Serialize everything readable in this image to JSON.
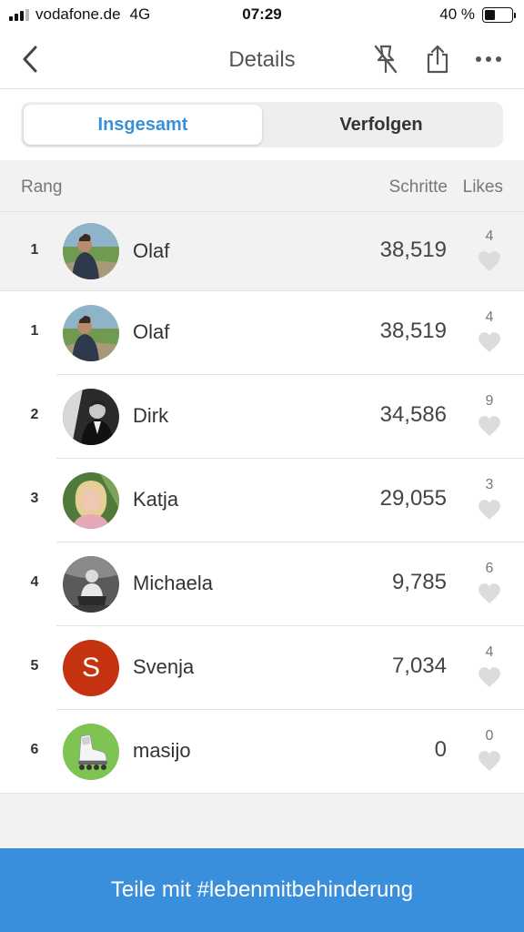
{
  "status_bar": {
    "carrier": "vodafone.de",
    "network": "4G",
    "time": "07:29",
    "battery": "40 %",
    "battery_level": 0.4
  },
  "nav": {
    "title": "Details",
    "icons": [
      "back-chevron-icon",
      "pin-off-icon",
      "share-icon",
      "more-icon"
    ]
  },
  "tabs": [
    {
      "label": "Insgesamt",
      "active": true
    },
    {
      "label": "Verfolgen",
      "active": false
    }
  ],
  "columns": {
    "rank": "Rang",
    "steps": "Schritte",
    "likes": "Likes"
  },
  "my_entry": {
    "rank": "1",
    "name": "Olaf",
    "steps": "38,519",
    "likes": "4"
  },
  "leaderboard": [
    {
      "rank": "1",
      "name": "Olaf",
      "steps": "38,519",
      "likes": "4"
    },
    {
      "rank": "2",
      "name": "Dirk",
      "steps": "34,586",
      "likes": "9"
    },
    {
      "rank": "3",
      "name": "Katja",
      "steps": "29,055",
      "likes": "3"
    },
    {
      "rank": "4",
      "name": "Michaela",
      "steps": "9,785",
      "likes": "6"
    },
    {
      "rank": "5",
      "name": "Svenja",
      "steps": "7,034",
      "likes": "4"
    },
    {
      "rank": "6",
      "name": "masijo",
      "steps": "0",
      "likes": "0"
    }
  ],
  "avatar_letter_svenja": "S",
  "footer_button": "Teile mit #lebenmitbehinderung",
  "colors": {
    "accent": "#3a8fdd",
    "tab_active_text": "#3a8fd9",
    "svenja_avatar": "#c4320f",
    "masijo_avatar": "#7dc452"
  }
}
